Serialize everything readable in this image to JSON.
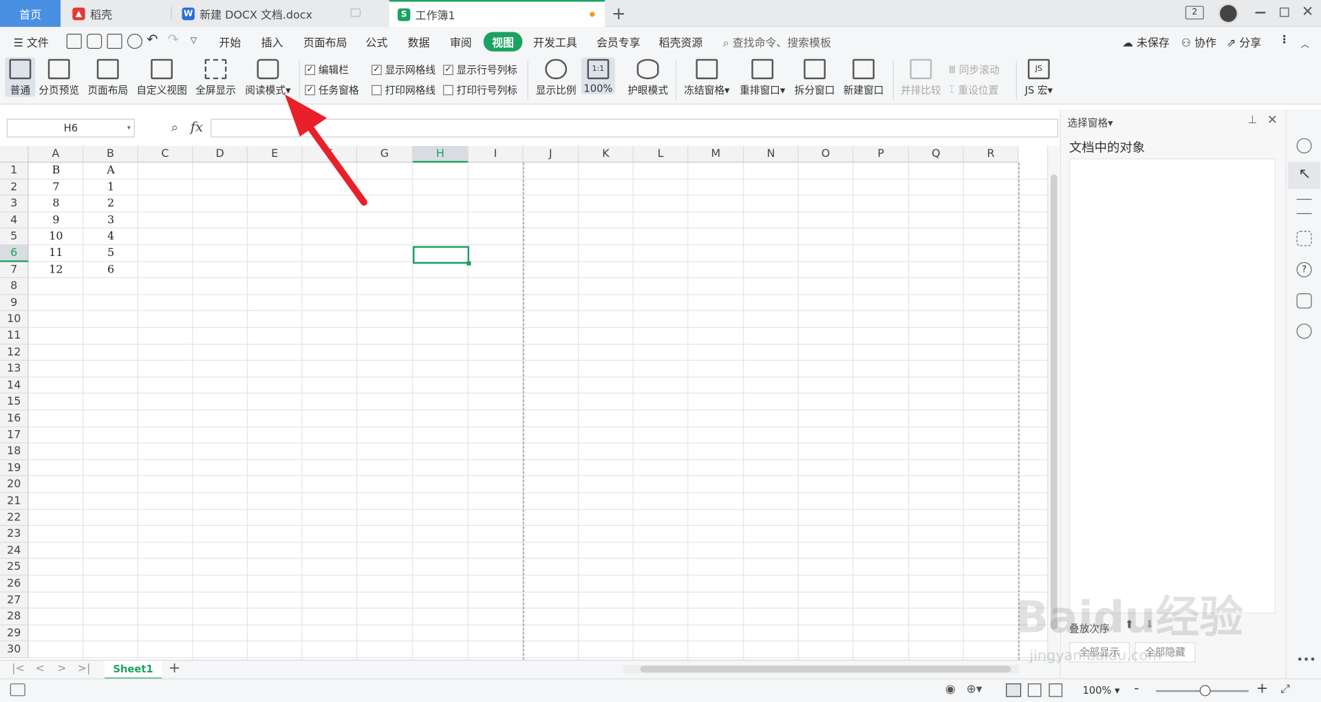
{
  "tabs": {
    "home": "首页",
    "daoke": "稻壳",
    "doc": "新建 DOCX 文档.docx",
    "sheet": "工作簿1",
    "new_tab": "+"
  },
  "menu": {
    "file": "文件",
    "items": [
      "开始",
      "插入",
      "页面布局",
      "公式",
      "数据",
      "审阅",
      "视图",
      "开发工具",
      "会员专享",
      "稻壳资源"
    ],
    "search": "查找命令、搜索模板",
    "unsaved": "未保存",
    "collab": "协作",
    "share": "分享"
  },
  "ribbon": {
    "normal": "普通",
    "page_preview": "分页预览",
    "page_layout": "页面布局",
    "custom_view": "自定义视图",
    "fullscreen": "全屏显示",
    "reading_mode": "阅读模式",
    "edit_bar": "编辑栏",
    "task_pane": "任务窗格",
    "show_grid": "显示网格线",
    "print_grid": "打印网格线",
    "show_rowcol": "显示行号列标",
    "print_rowcol": "打印行号列标",
    "zoom": "显示比例",
    "zoom100": "100%",
    "eye_mode": "护眼模式",
    "freeze": "冻结窗格",
    "rearrange": "重排窗口",
    "split": "拆分窗口",
    "new_window": "新建窗口",
    "side_by_side": "并排比较",
    "sync_scroll": "同步滚动",
    "reset_pos": "重设位置",
    "js_macro": "JS 宏"
  },
  "formula": {
    "cell_ref": "H6",
    "fx": "fx"
  },
  "columns": [
    "A",
    "B",
    "C",
    "D",
    "E",
    "F",
    "G",
    "H",
    "I",
    "J",
    "K",
    "L",
    "M",
    "N",
    "O",
    "P",
    "Q",
    "R"
  ],
  "rows": [
    "1",
    "2",
    "3",
    "4",
    "5",
    "6",
    "7",
    "8",
    "9",
    "10",
    "11",
    "12",
    "13",
    "14",
    "15",
    "16",
    "17",
    "18",
    "19",
    "20",
    "21",
    "22",
    "23",
    "24",
    "25",
    "26",
    "27",
    "28",
    "29",
    "30"
  ],
  "cells": {
    "A": [
      "B",
      "7",
      "8",
      "9",
      "10",
      "11",
      "12"
    ],
    "B": [
      "A",
      "1",
      "2",
      "3",
      "4",
      "5",
      "6"
    ]
  },
  "panel": {
    "title": "选择窗格",
    "subtitle": "文档中的对象",
    "sort": "叠放次序",
    "show_all": "全部显示",
    "hide_all": "全部隐藏"
  },
  "sheets": {
    "active": "Sheet1",
    "add": "+"
  },
  "status": {
    "zoom": "100%",
    "minus": "-",
    "plus": "+"
  },
  "watermark": {
    "brand": "Baidu经验",
    "url": "jingyan.baidu.com"
  },
  "colors": {
    "accent": "#1aa260",
    "home_tab": "#4a90e2",
    "arrow": "#e8202a"
  }
}
